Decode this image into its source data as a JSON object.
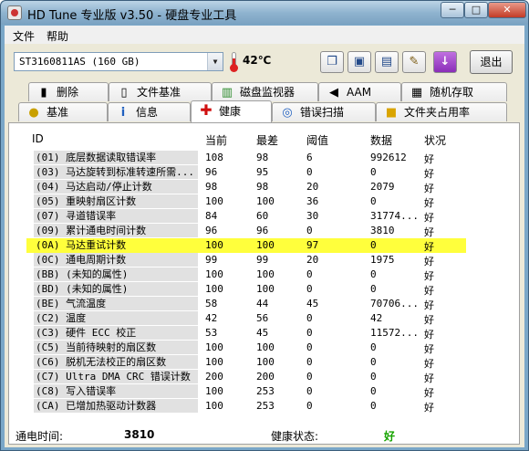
{
  "window": {
    "title": "HD Tune 专业版 v3.50 - 硬盘专业工具",
    "min": "─",
    "max": "□",
    "close": "✕"
  },
  "menu": [
    "文件",
    "帮助"
  ],
  "toolbar": {
    "drive": "ST3160811AS (160 GB)",
    "temperature": "42℃",
    "exit_label": "退出"
  },
  "tabs_top": [
    "删除",
    "文件基准",
    "磁盘监视器",
    "AAM",
    "随机存取"
  ],
  "tabs_bottom": [
    "基准",
    "信息",
    "健康",
    "错误扫描",
    "文件夹占用率"
  ],
  "active_tab": "健康",
  "table": {
    "headers": [
      "ID",
      "当前",
      "最差",
      "阈值",
      "数据",
      "状况"
    ],
    "rows": [
      {
        "id": "(01) 底层数据读取错误率",
        "current": "108",
        "worst": "98",
        "threshold": "6",
        "data": "992612",
        "status": "好"
      },
      {
        "id": "(03) 马达旋转到标准转速所需...",
        "current": "96",
        "worst": "95",
        "threshold": "0",
        "data": "0",
        "status": "好"
      },
      {
        "id": "(04) 马达启动/停止计数",
        "current": "98",
        "worst": "98",
        "threshold": "20",
        "data": "2079",
        "status": "好"
      },
      {
        "id": "(05) 重映射扇区计数",
        "current": "100",
        "worst": "100",
        "threshold": "36",
        "data": "0",
        "status": "好"
      },
      {
        "id": "(07) 寻道错误率",
        "current": "84",
        "worst": "60",
        "threshold": "30",
        "data": "31774...",
        "status": "好"
      },
      {
        "id": "(09) 累计通电时间计数",
        "current": "96",
        "worst": "96",
        "threshold": "0",
        "data": "3810",
        "status": "好"
      },
      {
        "id": "(0A) 马达重试计数",
        "current": "100",
        "worst": "100",
        "threshold": "97",
        "data": "0",
        "status": "好",
        "highlight": true
      },
      {
        "id": "(0C) 通电周期计数",
        "current": "99",
        "worst": "99",
        "threshold": "20",
        "data": "1975",
        "status": "好"
      },
      {
        "id": "(BB) (未知的属性)",
        "current": "100",
        "worst": "100",
        "threshold": "0",
        "data": "0",
        "status": "好"
      },
      {
        "id": "(BD) (未知的属性)",
        "current": "100",
        "worst": "100",
        "threshold": "0",
        "data": "0",
        "status": "好"
      },
      {
        "id": "(BE) 气流温度",
        "current": "58",
        "worst": "44",
        "threshold": "45",
        "data": "70706...",
        "status": "好"
      },
      {
        "id": "(C2) 温度",
        "current": "42",
        "worst": "56",
        "threshold": "0",
        "data": "42",
        "status": "好"
      },
      {
        "id": "(C3) 硬件 ECC 校正",
        "current": "53",
        "worst": "45",
        "threshold": "0",
        "data": "11572...",
        "status": "好"
      },
      {
        "id": "(C5) 当前待映射的扇区数",
        "current": "100",
        "worst": "100",
        "threshold": "0",
        "data": "0",
        "status": "好"
      },
      {
        "id": "(C6) 脱机无法校正的扇区数",
        "current": "100",
        "worst": "100",
        "threshold": "0",
        "data": "0",
        "status": "好"
      },
      {
        "id": "(C7) Ultra DMA CRC 错误计数",
        "current": "200",
        "worst": "200",
        "threshold": "0",
        "data": "0",
        "status": "好"
      },
      {
        "id": "(C8) 写入错误率",
        "current": "100",
        "worst": "253",
        "threshold": "0",
        "data": "0",
        "status": "好"
      },
      {
        "id": "(CA) 已增加热驱动计数器",
        "current": "100",
        "worst": "253",
        "threshold": "0",
        "data": "0",
        "status": "好"
      }
    ]
  },
  "footer": {
    "power_on_label": "通电时间:",
    "power_on_value": "3810",
    "health_label": "健康状态:",
    "health_value": "好"
  },
  "colors": {
    "highlight": "#ffff3c",
    "ok": "#17a300"
  }
}
